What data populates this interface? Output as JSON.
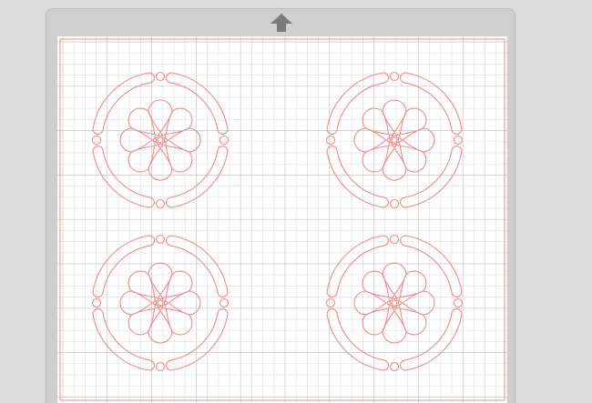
{
  "app": {
    "view": "cutting-mat-preview"
  },
  "toolbar": {
    "load_arrow_icon": "arrow-up-icon"
  },
  "colors": {
    "background": "#dcdcdc",
    "mat_frame": "#cfcfcf",
    "grid_minor": "#e3e3e3",
    "grid_major": "#c6c6c6",
    "cut_line": "#f08c8c",
    "arrow": "#7a7a7a"
  },
  "mat": {
    "grid_columns": 40,
    "grid_rows": 33,
    "major_every": 4,
    "designs": [
      {
        "name": "flower-medallion-top-left",
        "rotation": 0
      },
      {
        "name": "flower-medallion-top-right",
        "rotation": 0
      },
      {
        "name": "flower-medallion-bottom-left",
        "rotation": 0
      },
      {
        "name": "flower-medallion-bottom-right",
        "rotation": 0
      }
    ]
  }
}
